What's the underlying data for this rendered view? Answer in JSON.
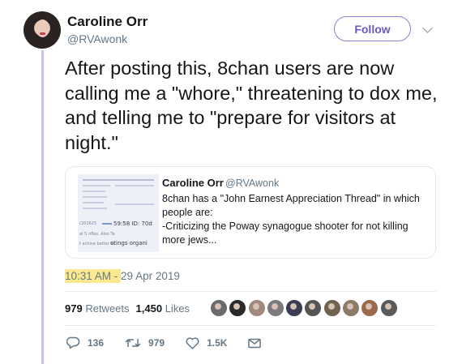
{
  "author": {
    "name": "Caroline Orr",
    "handle": "@RVAwonk"
  },
  "follow_label": "Follow",
  "tweet_text": "After posting this, 8chan users are now calling me a \"whore,\" threatening to dox me, and telling me to \"prepare for visitors at night.\"",
  "quoted": {
    "name": "Caroline Orr",
    "handle": "@RVAwonk",
    "text": "8chan has a \"John Earnest Appreciation Thread\" in which people are:\n -Criticizing the Poway synagogue shooter for not killing more jews...",
    "thumb_text": {
      "id_line_left": "(201625",
      "id_line_right": "59:58 ID: 70d",
      "line_files": "al 5 rifles. Also Ta",
      "line_achieve": "t achive better sc",
      "line_otings": "otings organi"
    }
  },
  "timestamp": {
    "time": "10:31 AM",
    "separator": " - ",
    "date": "29 Apr 2019"
  },
  "stats": {
    "retweets_count": "979",
    "retweets_label": "Retweets",
    "likes_count": "1,450",
    "likes_label": "Likes"
  },
  "liker_avatar_colors": [
    "#6b6b6b",
    "#2a2a2a",
    "#a08a7e",
    "#7a7a7a",
    "#3c3c52",
    "#555555",
    "#6f6250",
    "#8d7a66",
    "#9a6a4a",
    "#5a5a5a"
  ],
  "actions": {
    "replies": "136",
    "retweets": "979",
    "likes": "1.5K"
  },
  "icons": [
    "reply-icon",
    "retweet-icon",
    "heart-icon",
    "mail-icon",
    "chevron-down-icon"
  ]
}
